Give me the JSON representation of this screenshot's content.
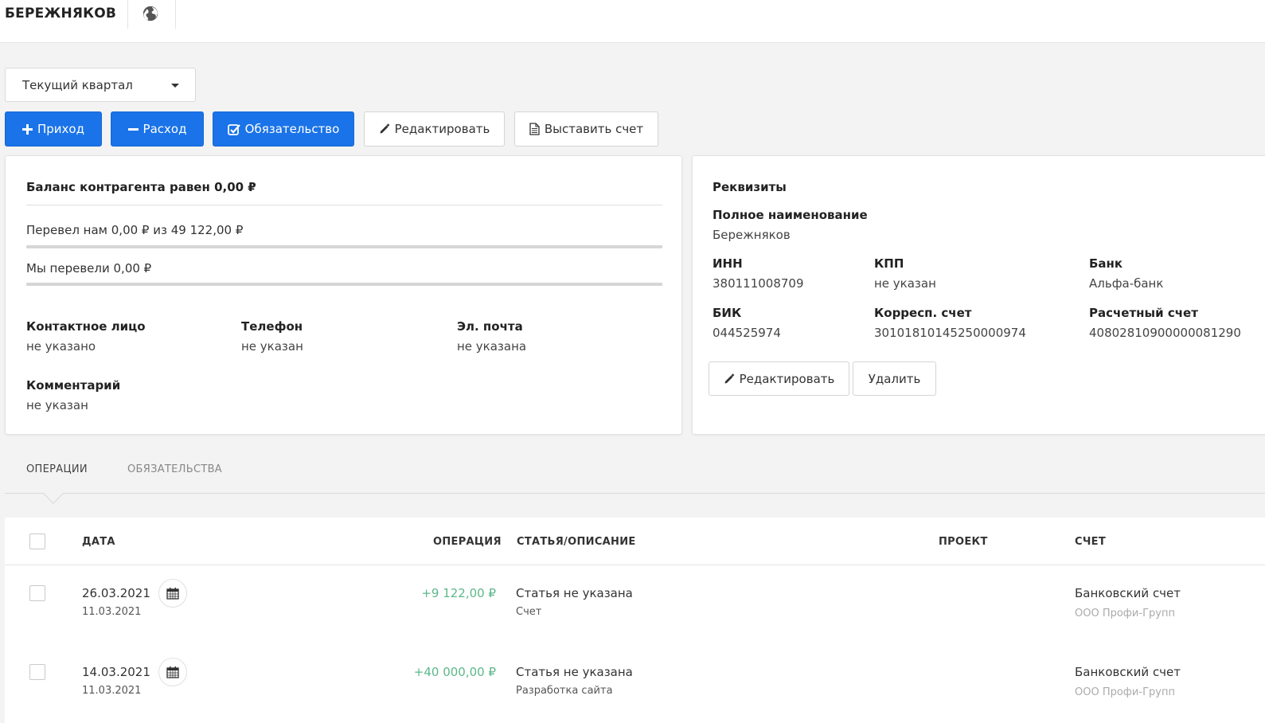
{
  "header": {
    "title": "БЕРЕЖНЯКОВ",
    "globe_icon": "globe-icon"
  },
  "period_select": {
    "value": "Текущий квартал"
  },
  "toolbar": {
    "income_label": "Приход",
    "expense_label": "Расход",
    "obligation_label": "Обязательство",
    "edit_label": "Редактировать",
    "invoice_label": "Выставить счет"
  },
  "balance": {
    "title": "Баланс контрагента равен 0,00 ₽",
    "received_text": "Перевел нам 0,00 ₽ из 49 122,00 ₽",
    "received_progress": 0,
    "sent_text": "Мы перевели 0,00 ₽",
    "sent_progress": 0
  },
  "contact": {
    "person_label": "Контактное лицо",
    "person_value": "не указано",
    "phone_label": "Телефон",
    "phone_value": "не указан",
    "email_label": "Эл. почта",
    "email_value": "не указана",
    "comment_label": "Комментарий",
    "comment_value": "не указан"
  },
  "requisites": {
    "title": "Реквизиты",
    "full_name_label": "Полное наименование",
    "full_name_value": "Бережняков",
    "inn_label": "ИНН",
    "inn_value": "380111008709",
    "kpp_label": "КПП",
    "kpp_value": "не указан",
    "bank_label": "Банк",
    "bank_value": "Альфа-банк",
    "bik_label": "БИК",
    "bik_value": "044525974",
    "corr_label": "Корресп. счет",
    "corr_value": "30101810145250000974",
    "account_label": "Расчетный счет",
    "account_value": "40802810900000081290",
    "edit_label": "Редактировать",
    "delete_label": "Удалить"
  },
  "tabs": {
    "operations": "ОПЕРАЦИИ",
    "obligations": "ОБЯЗАТЕЛЬСТВА",
    "active": "operations"
  },
  "table": {
    "columns": {
      "date": "ДАТА",
      "operation": "ОПЕРАЦИЯ",
      "description": "СТАТЬЯ/ОПИСАНИЕ",
      "project": "ПРОЕКТ",
      "account": "СЧЕТ"
    },
    "rows": [
      {
        "date": "26.03.2021",
        "date_sub": "11.03.2021",
        "amount": "+9 122,00 ₽",
        "desc": "Статья не указана",
        "desc_sub": "Счет",
        "project": "",
        "account": "Банковский счет",
        "account_sub": "ООО Профи-Групп"
      },
      {
        "date": "14.03.2021",
        "date_sub": "11.03.2021",
        "amount": "+40 000,00 ₽",
        "desc": "Статья не указана",
        "desc_sub": "Разработка сайта",
        "project": "",
        "account": "Банковский счет",
        "account_sub": "ООО Профи-Групп"
      }
    ]
  },
  "colors": {
    "primary": "#1a73e8",
    "income_amount": "#5cb88a",
    "background": "#f3f3f3"
  }
}
